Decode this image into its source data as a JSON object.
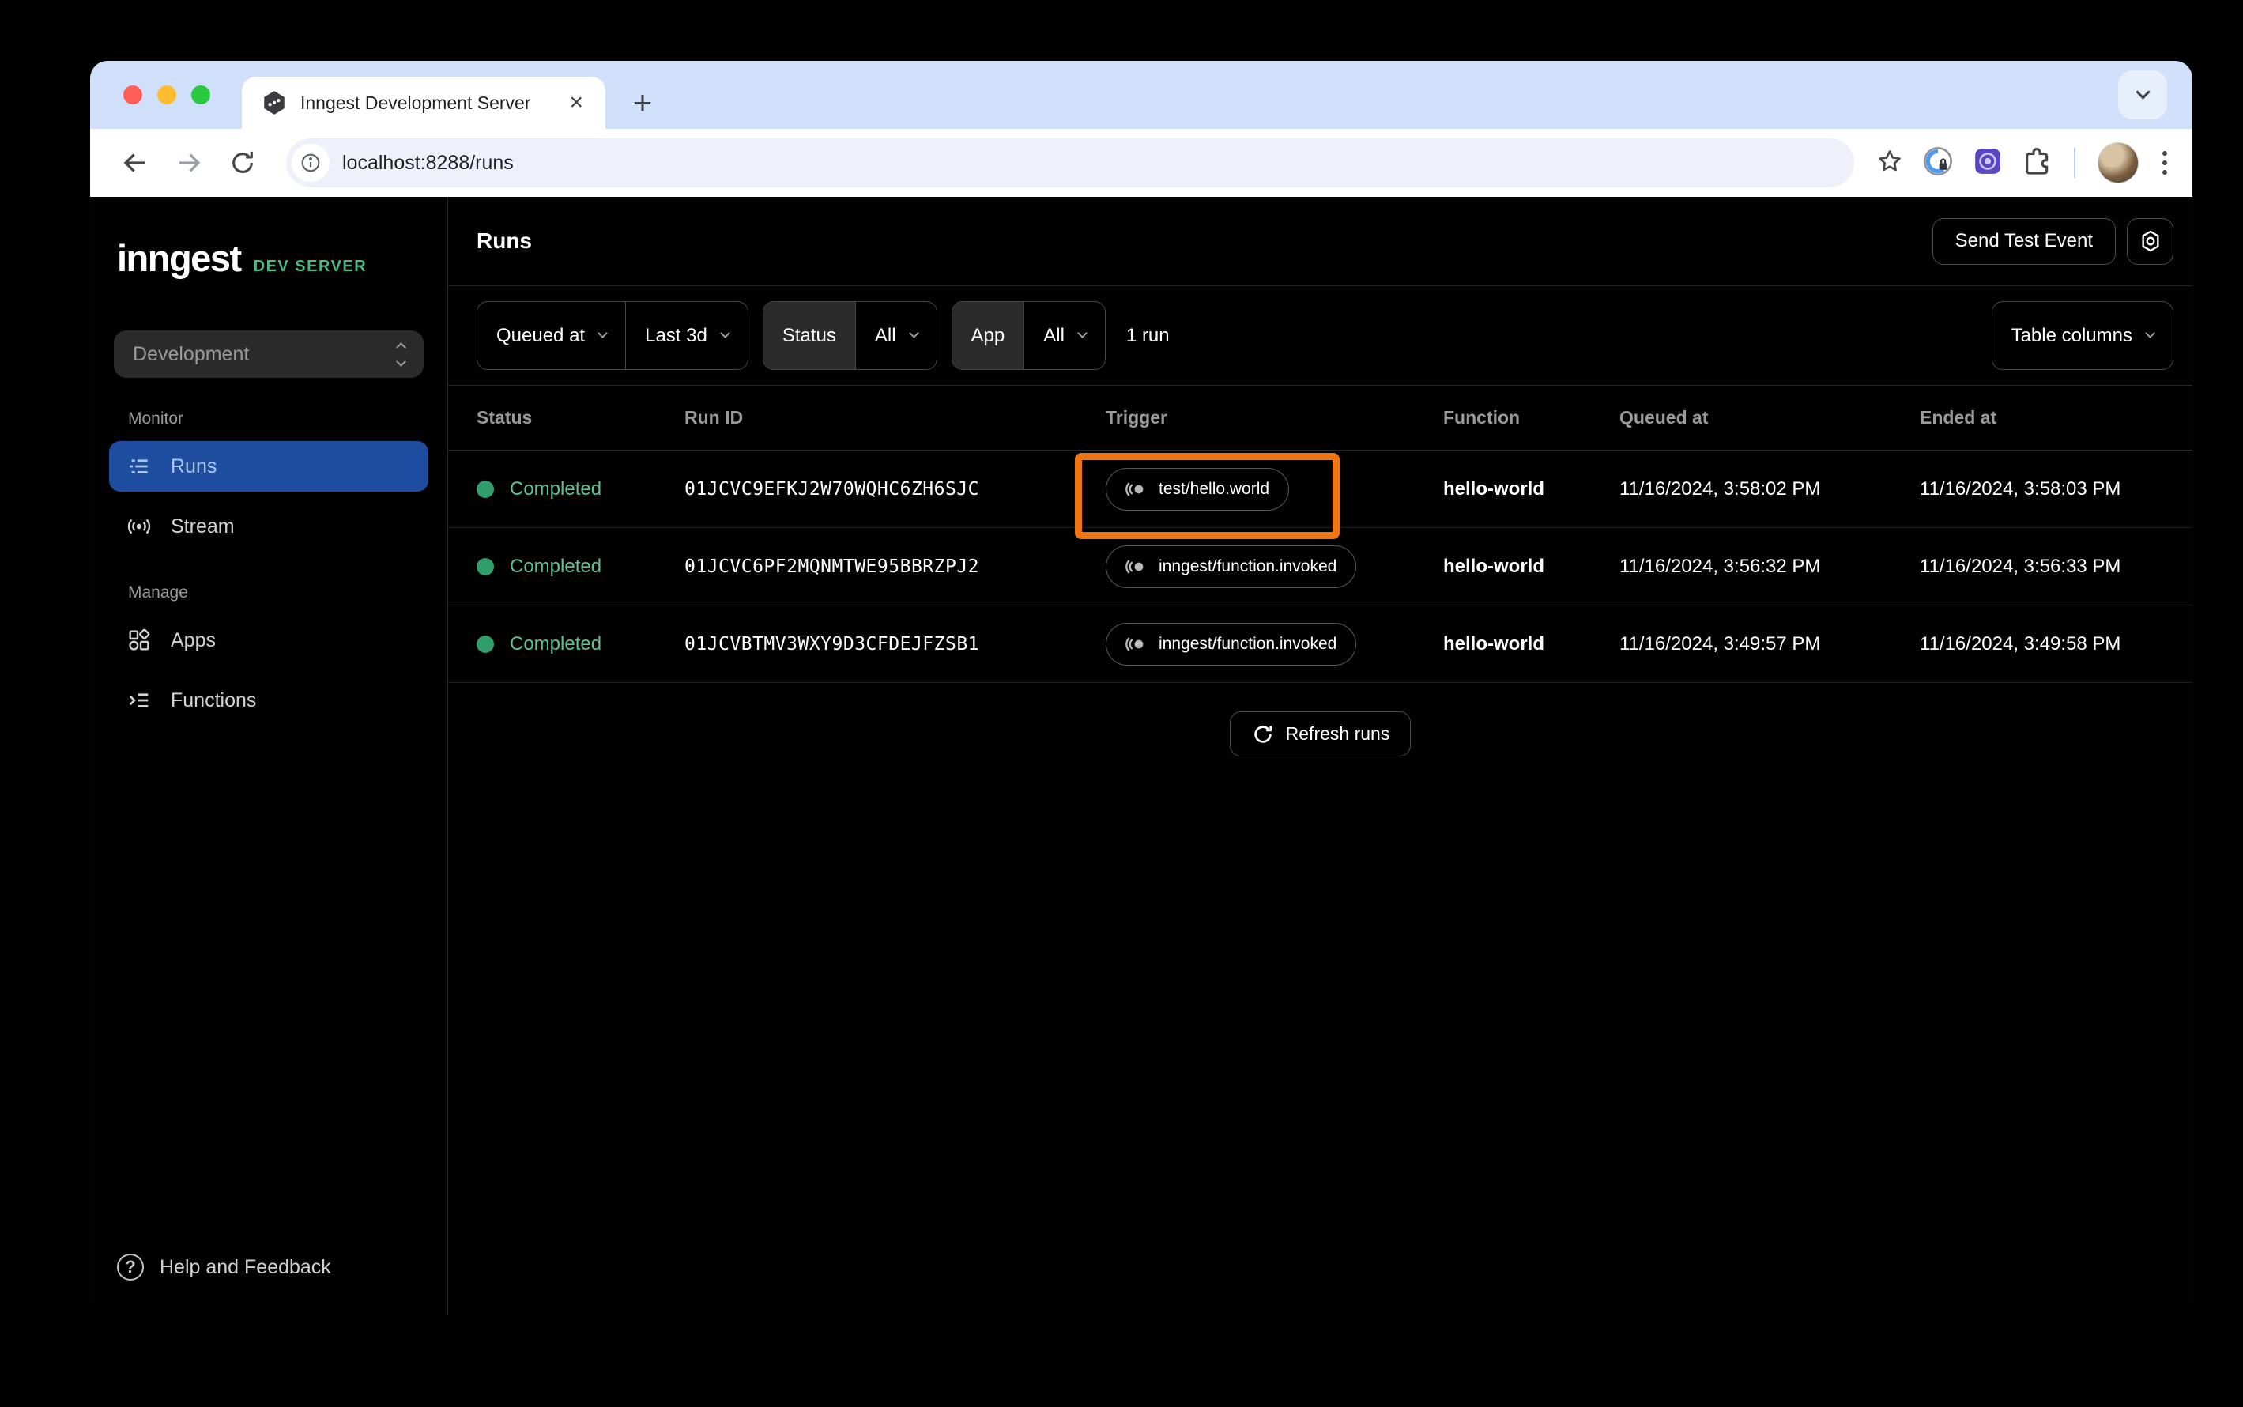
{
  "browser": {
    "tab_title": "Inngest Development Server",
    "close_glyph": "×",
    "new_tab_glyph": "+",
    "url": "localhost:8288/runs"
  },
  "sidebar": {
    "logo_text": "inngest",
    "logo_badge": "DEV SERVER",
    "environment": "Development",
    "monitor_label": "Monitor",
    "manage_label": "Manage",
    "nav": {
      "runs": "Runs",
      "stream": "Stream",
      "apps": "Apps",
      "functions": "Functions"
    },
    "help_label": "Help and Feedback"
  },
  "header": {
    "title": "Runs",
    "send_test_event_label": "Send Test Event"
  },
  "filters": {
    "sort_field": "Queued at",
    "time_range": "Last 3d",
    "status_label": "Status",
    "status_value": "All",
    "app_label": "App",
    "app_value": "All",
    "run_count": "1 run",
    "table_columns_label": "Table columns"
  },
  "table": {
    "columns": [
      "Status",
      "Run ID",
      "Trigger",
      "Function",
      "Queued at",
      "Ended at"
    ],
    "rows": [
      {
        "status": "Completed",
        "run_id": "01JCVC9EFKJ2W70WQHC6ZH6SJC",
        "trigger": "test/hello.world",
        "function": "hello-world",
        "queued_at": "11/16/2024, 3:58:02 PM",
        "ended_at": "11/16/2024, 3:58:03 PM",
        "highlighted": true
      },
      {
        "status": "Completed",
        "run_id": "01JCVC6PF2MQNMTWE95BBRZPJ2",
        "trigger": "inngest/function.invoked",
        "function": "hello-world",
        "queued_at": "11/16/2024, 3:56:32 PM",
        "ended_at": "11/16/2024, 3:56:33 PM",
        "highlighted": false
      },
      {
        "status": "Completed",
        "run_id": "01JCVBTMV3WXY9D3CFDEJFZSB1",
        "trigger": "inngest/function.invoked",
        "function": "hello-world",
        "queued_at": "11/16/2024, 3:49:57 PM",
        "ended_at": "11/16/2024, 3:49:58 PM",
        "highlighted": false
      }
    ],
    "refresh_label": "Refresh runs"
  },
  "icons": {
    "favicon": "inngest-hexagon-icon",
    "runs": "run-list-icon",
    "stream": "broadcast-icon",
    "apps": "shapes-grid-icon",
    "functions": "function-list-icon",
    "trigger": "event-pulse-icon",
    "settings": "gear-icon",
    "refresh": "refresh-icon",
    "help": "question-circle-icon"
  },
  "colors": {
    "tab_strip": "#d0e0fb",
    "app_background": "#010101",
    "active_nav_blue": "#1e4d9f",
    "success_green": "#61c193",
    "brand_green": "#4cb882",
    "highlight_orange": "#ef7412"
  }
}
